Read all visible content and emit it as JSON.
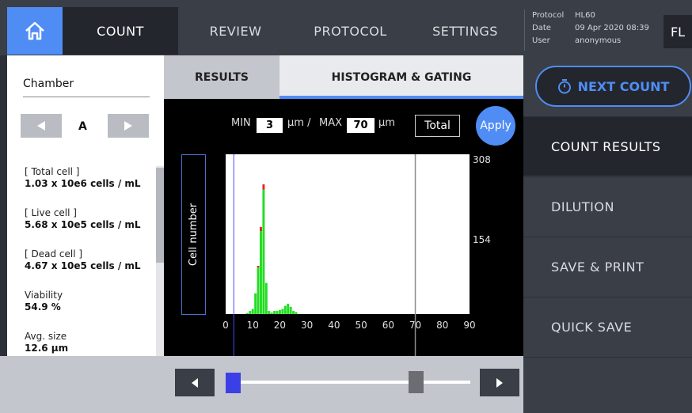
{
  "topbar": {
    "tabs": [
      {
        "label": "COUNT",
        "active": true
      },
      {
        "label": "REVIEW"
      },
      {
        "label": "PROTOCOL"
      },
      {
        "label": "SETTINGS"
      }
    ],
    "info": {
      "protocol_key": "Protocol",
      "protocol_val": "HL60",
      "date_key": "Date",
      "date_val": "09 Apr 2020 08:39",
      "user_key": "User",
      "user_val": "anonymous"
    },
    "lang": "FL",
    "home_icon": "home-icon"
  },
  "left": {
    "chamber_label": "Chamber",
    "chamber_value": "A",
    "stats": [
      {
        "label": "[ Total cell ]",
        "value": "1.03 x 10e6 cells / mL"
      },
      {
        "label": "[ Live cell ]",
        "value": "5.68 x 10e5 cells / mL"
      },
      {
        "label": "[ Dead cell ]",
        "value": "4.67 x 10e5 cells / mL"
      },
      {
        "label": "Viability",
        "value": "54.9 %"
      },
      {
        "label": "Avg. size",
        "value": "12.6 µm"
      }
    ]
  },
  "subtabs": {
    "results": "RESULTS",
    "histogram": "HISTOGRAM & GATING"
  },
  "controls": {
    "min_label": "MIN",
    "min_value": "3",
    "unit1": "µm /",
    "max_label": "MAX",
    "max_value": "70",
    "unit2": "µm",
    "total": "Total",
    "apply": "Apply"
  },
  "chart_data": {
    "type": "bar",
    "ylabel": "Cell number",
    "ylim": [
      0,
      308
    ],
    "xlim": [
      0,
      90
    ],
    "xticks": [
      "0",
      "10",
      "20",
      "30",
      "40",
      "50",
      "60",
      "70",
      "80",
      "90"
    ],
    "yticks": [
      "308",
      "154"
    ],
    "gate_min": 3,
    "gate_max": 70,
    "series": [
      {
        "color": "#22dd22",
        "x": [
          8,
          9,
          10,
          11,
          12,
          13,
          14,
          15,
          16,
          17,
          18,
          19,
          20,
          21,
          22,
          23,
          24,
          25,
          26
        ],
        "values": [
          2,
          6,
          10,
          40,
          90,
          160,
          240,
          60,
          6,
          3,
          6,
          6,
          8,
          10,
          16,
          20,
          14,
          6,
          4
        ]
      },
      {
        "color": "#ee2222",
        "x": [
          12,
          13,
          14
        ],
        "values": [
          3,
          8,
          10
        ]
      }
    ]
  },
  "bottombar": {
    "left_icon": "arrow-left-icon",
    "right_icon": "arrow-right-icon"
  },
  "right": {
    "next_count": "NEXT COUNT",
    "menu": [
      "COUNT RESULTS",
      "DILUTION",
      "SAVE & PRINT",
      "QUICK SAVE"
    ]
  }
}
